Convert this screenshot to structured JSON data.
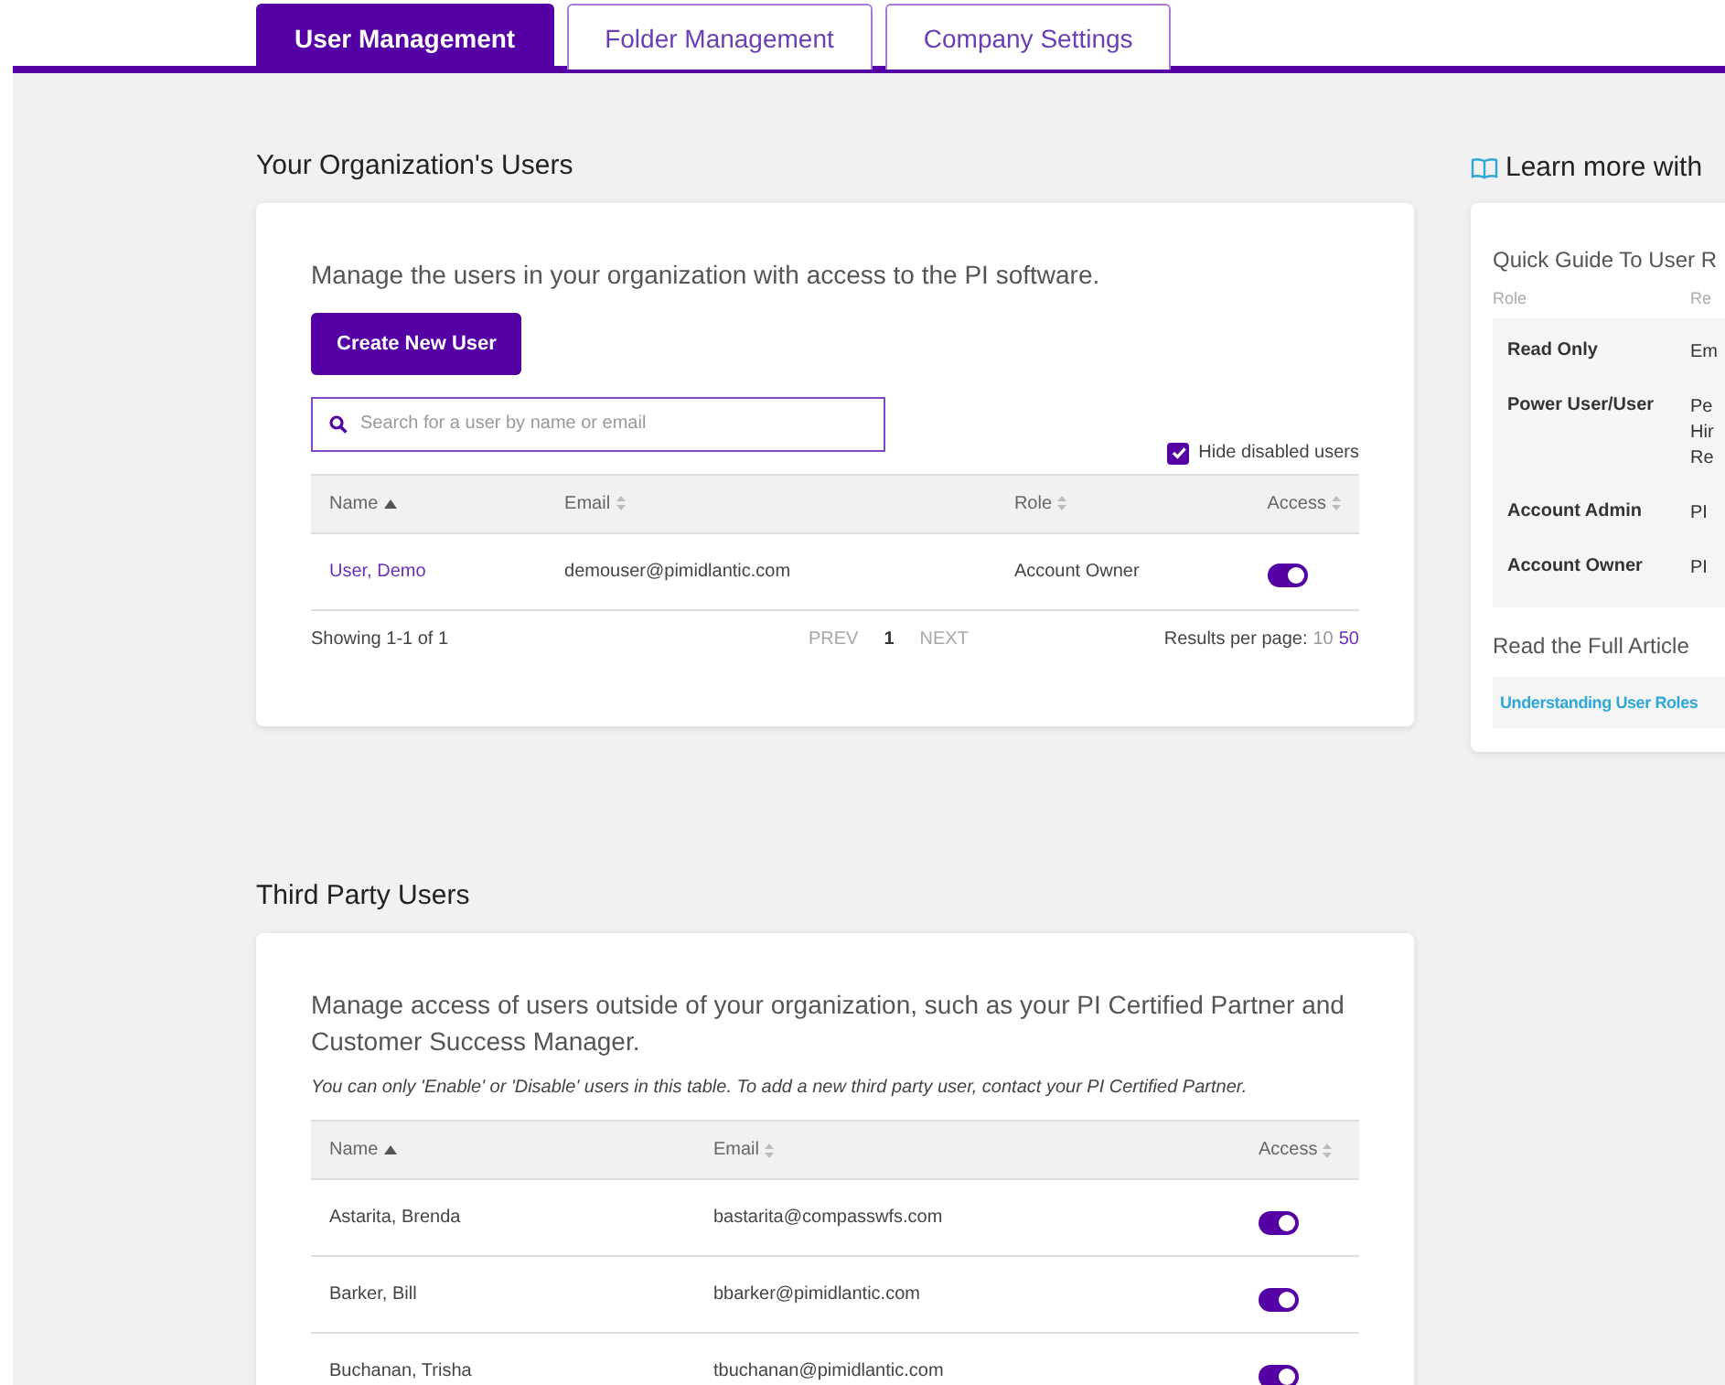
{
  "tabs": [
    {
      "label": "User Management",
      "selected": true
    },
    {
      "label": "Folder Management",
      "selected": false
    },
    {
      "label": "Company Settings",
      "selected": false
    }
  ],
  "org_users": {
    "title": "Your Organization's Users",
    "description": "Manage the users in your organization with access to the PI software.",
    "create_button": "Create New User",
    "search": {
      "placeholder": "Search for a user by name or email"
    },
    "hide_disabled": {
      "label": "Hide disabled users",
      "checked": true
    },
    "columns": [
      {
        "label": "Name",
        "sorted": true
      },
      {
        "label": "Email",
        "sorted": false
      },
      {
        "label": "Role",
        "sorted": false
      },
      {
        "label": "Access",
        "sorted": false
      }
    ],
    "rows": [
      {
        "name": "User, Demo",
        "email": "demouser@pimidlantic.com",
        "role": "Account Owner",
        "access": true
      }
    ],
    "showing": "Showing 1-1 of 1",
    "pagination": {
      "prev": {
        "label": "PREV",
        "disabled": true
      },
      "pages": [
        {
          "label": "1",
          "selected": true
        }
      ],
      "next": {
        "label": "NEXT",
        "disabled": true
      }
    },
    "results_per_page": {
      "label": "Results per page:",
      "options": [
        {
          "label": "10",
          "selected": true
        },
        {
          "label": "50",
          "selected": false
        }
      ]
    }
  },
  "learn_more": {
    "title": "Learn more with",
    "guide_title": "Quick Guide To User R",
    "columns": [
      "Role",
      "Re"
    ],
    "rows": [
      {
        "role": "Read Only",
        "text": [
          "Em"
        ]
      },
      {
        "role": "Power User/User",
        "text": [
          "Pe",
          "Hir",
          "Re"
        ]
      },
      {
        "role": "Account Admin",
        "text": [
          "PI"
        ]
      },
      {
        "role": "Account Owner",
        "text": [
          "PI"
        ]
      }
    ],
    "article_title": "Read the Full Article",
    "article_link": "Understanding User Roles"
  },
  "third_party": {
    "title": "Third Party Users",
    "description": "Manage access of users outside of your organization, such as your PI Certified Partner and Customer Success Manager.",
    "note": "You can only 'Enable' or 'Disable' users in this table. To add a new third party user, contact your PI Certified Partner.",
    "columns": [
      {
        "label": "Name",
        "sorted": true
      },
      {
        "label": "Email",
        "sorted": false
      },
      {
        "label": "Access",
        "sorted": false
      }
    ],
    "rows": [
      {
        "name": "Astarita, Brenda",
        "email": "bastarita@compasswfs.com",
        "access": true
      },
      {
        "name": "Barker, Bill",
        "email": "bbarker@pimidlantic.com",
        "access": true
      },
      {
        "name": "Buchanan, Trisha",
        "email": "tbuchanan@pimidlantic.com",
        "access": true
      }
    ]
  }
}
